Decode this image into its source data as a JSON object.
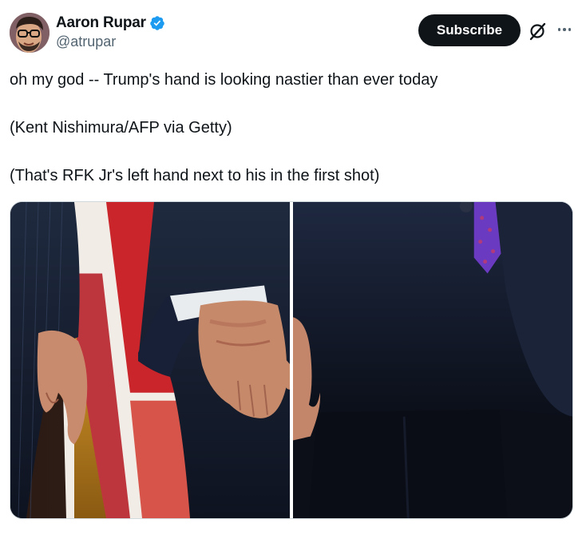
{
  "author": {
    "display_name": "Aaron Rupar",
    "handle": "@atrupar",
    "verified": true,
    "verified_color": "#1d9bf0"
  },
  "actions": {
    "subscribe_label": "Subscribe",
    "grok_icon": "grok-icon",
    "more_icon": "more-options-icon"
  },
  "tweet": {
    "paragraphs": [
      "oh my god -- Trump's hand is looking nastier than ever today",
      "(Kent Nishimura/AFP via Getty)",
      "(That's RFK Jr's left hand next to his in the first shot)"
    ]
  },
  "media": {
    "photos": [
      {
        "name": "photo-hands-flag"
      },
      {
        "name": "photo-suit-tie"
      }
    ]
  },
  "colors": {
    "text_primary": "#0f1419",
    "text_secondary": "#536471",
    "button_bg": "#0f1419",
    "border": "#cfd9de"
  }
}
